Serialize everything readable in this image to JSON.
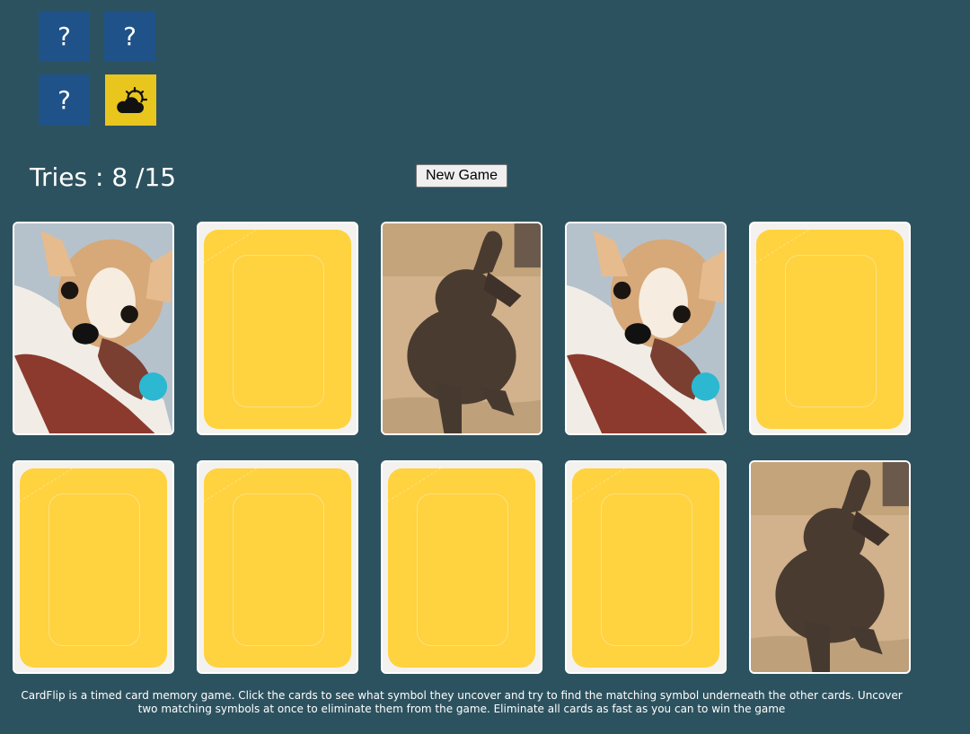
{
  "symbol_tiles": [
    {
      "label": "?",
      "icon": "question-mark-icon",
      "state": "hidden"
    },
    {
      "label": "?",
      "icon": "question-mark-icon",
      "state": "hidden"
    },
    {
      "label": "?",
      "icon": "question-mark-icon",
      "state": "hidden"
    },
    {
      "label": "",
      "icon": "weather-partly-cloudy-icon",
      "state": "revealed"
    }
  ],
  "tries": {
    "text": "Tries : 8 /15",
    "used": 8,
    "max": 15
  },
  "new_game_label": "New Game",
  "cards": [
    {
      "state": "face-up",
      "image": "puppy"
    },
    {
      "state": "face-down"
    },
    {
      "state": "face-up",
      "image": "elephant"
    },
    {
      "state": "face-up",
      "image": "puppy"
    },
    {
      "state": "face-down"
    },
    {
      "state": "face-down"
    },
    {
      "state": "face-down"
    },
    {
      "state": "face-down"
    },
    {
      "state": "face-down"
    },
    {
      "state": "face-up",
      "image": "elephant"
    }
  ],
  "instructions": "CardFlip is a timed card memory game. Click the cards to see what symbol they uncover and try to find the matching symbol underneath the other cards. Uncover two matching symbols at once to eliminate them from the game. Eliminate all cards as fast as you can to win the game",
  "colors": {
    "background": "#2d525f",
    "tile_hidden": "#1f5289",
    "tile_revealed": "#e8c61e",
    "card_back": "#ffd23f"
  }
}
